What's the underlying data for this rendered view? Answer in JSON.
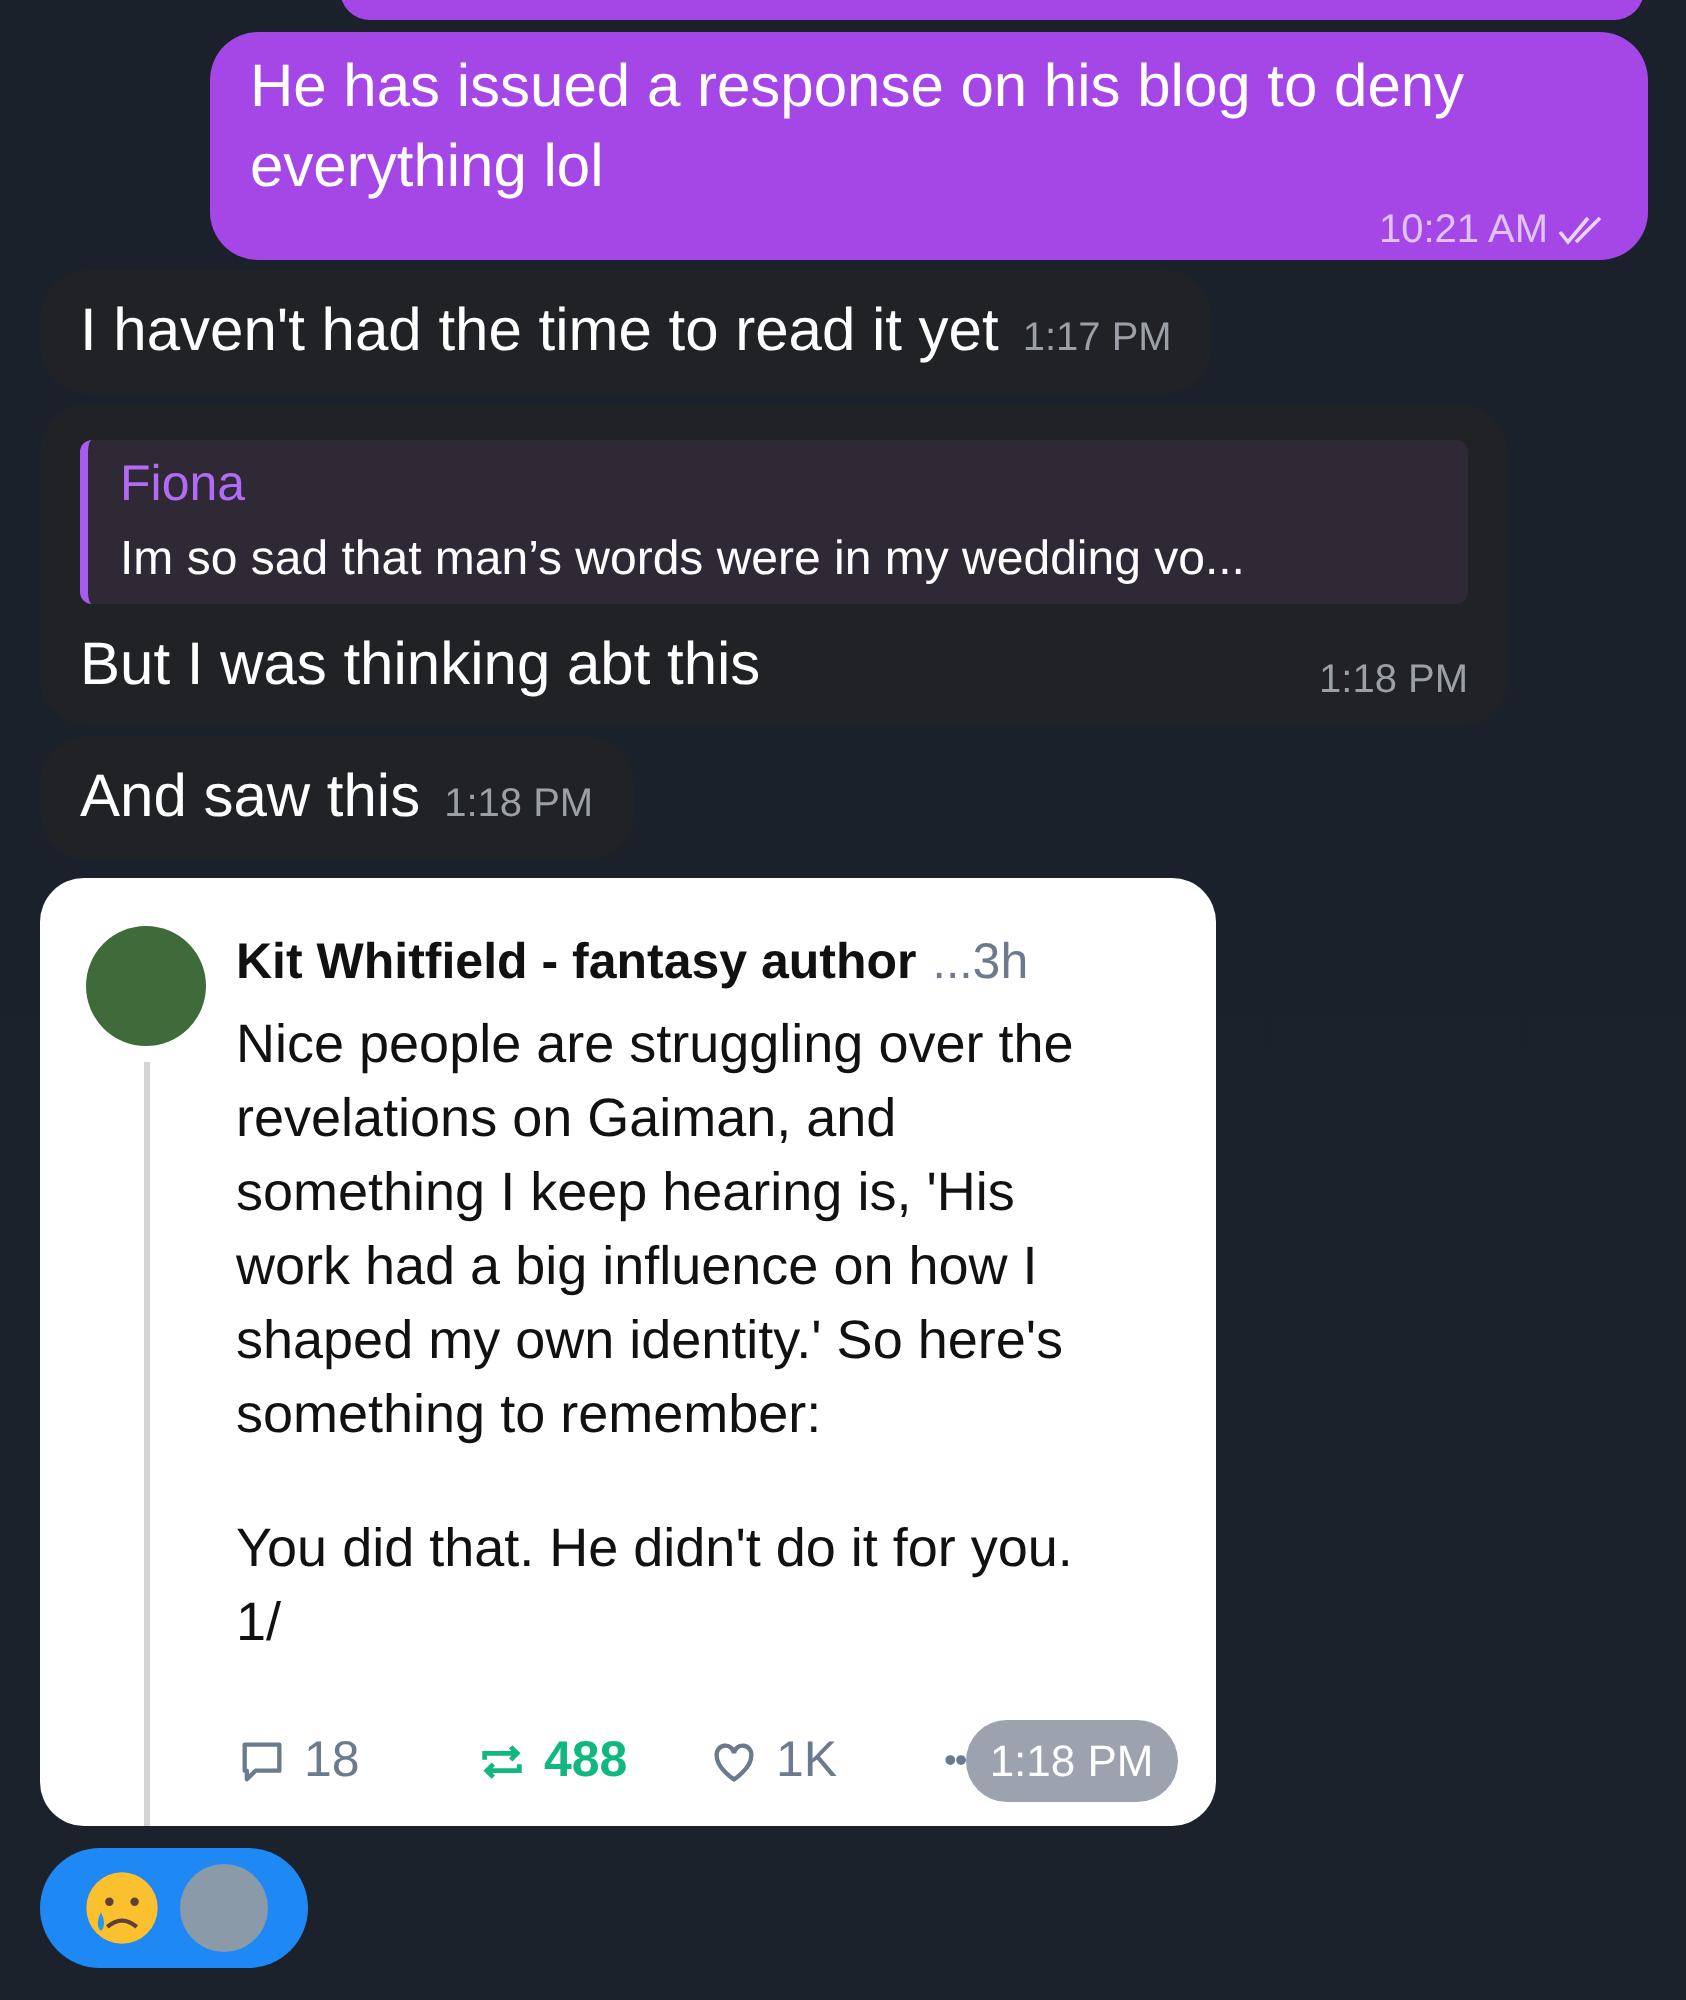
{
  "messages": [
    {
      "kind": "text",
      "outgoing": true,
      "text": "He has issued a response on his blog to deny everything lol",
      "time": "10:21 AM",
      "read": true
    },
    {
      "kind": "text",
      "outgoing": false,
      "text": "I haven't had the time to read it yet",
      "time": "1:17 PM"
    },
    {
      "kind": "reply",
      "outgoing": false,
      "quote_author": "Fiona",
      "quote_text": "Im so sad that man’s words were in my wedding vo...",
      "text": "But I was thinking abt this",
      "time": "1:18 PM"
    },
    {
      "kind": "text",
      "outgoing": false,
      "text": "And saw this",
      "time": "1:18 PM"
    },
    {
      "kind": "image",
      "outgoing": false,
      "time": "1:18 PM",
      "post": {
        "author": "Kit Whitfield - fantasy author",
        "more": "...",
        "age": "3h",
        "paragraphs": [
          "Nice people are struggling over the revelations on Gaiman, and something I keep hearing is, 'His work had a big influence on how I shaped my own identity.' So here's something to remember:",
          "You did that. He didn't do it for you. 1/"
        ],
        "replies": "18",
        "reposts": "488",
        "reposted": true,
        "likes": "1K",
        "menu": "••"
      }
    }
  ]
}
